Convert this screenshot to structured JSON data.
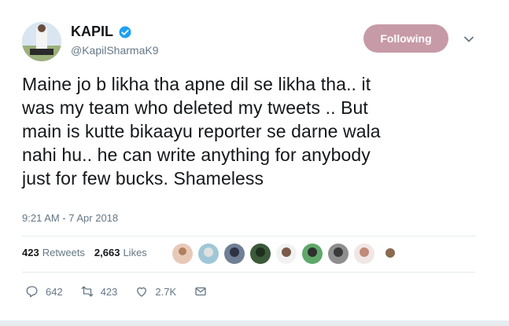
{
  "tweet": {
    "author_name": "KAPIL",
    "handle": "@KapilSharmaK9",
    "follow_label": "Following",
    "text": "Maine jo b likha tha apne dil se likha tha.. it\nwas my team who deleted  my tweets .. But\nmain is kutte bikaayu reporter se darne wala\nnahi hu..  he can write anything for anybody\njust for few bucks. Shameless",
    "timestamp": "9:21 AM - 7 Apr 2018",
    "retweets_count": "423",
    "retweets_label": "Retweets",
    "likes_count": "2,663",
    "likes_label": "Likes",
    "reply_count": "642",
    "retweet_action_count": "423",
    "like_action_count": "2.7K"
  },
  "colors": {
    "follow_button": "#c79aa7",
    "verified": "#1da1f2",
    "secondary_text": "#657786"
  },
  "icons": {
    "verified": "verified-badge-icon",
    "caret": "chevron-down-icon",
    "reply": "reply-icon",
    "retweet": "retweet-icon",
    "like": "heart-icon",
    "message": "direct-message-icon"
  }
}
